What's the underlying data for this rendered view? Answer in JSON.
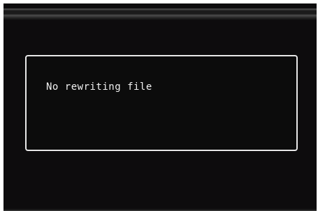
{
  "dialog": {
    "message": "No rewriting file"
  },
  "colors": {
    "screen_background": "#0d0c0d",
    "dialog_border": "#e8e8e8",
    "text": "#f2f2f2"
  }
}
